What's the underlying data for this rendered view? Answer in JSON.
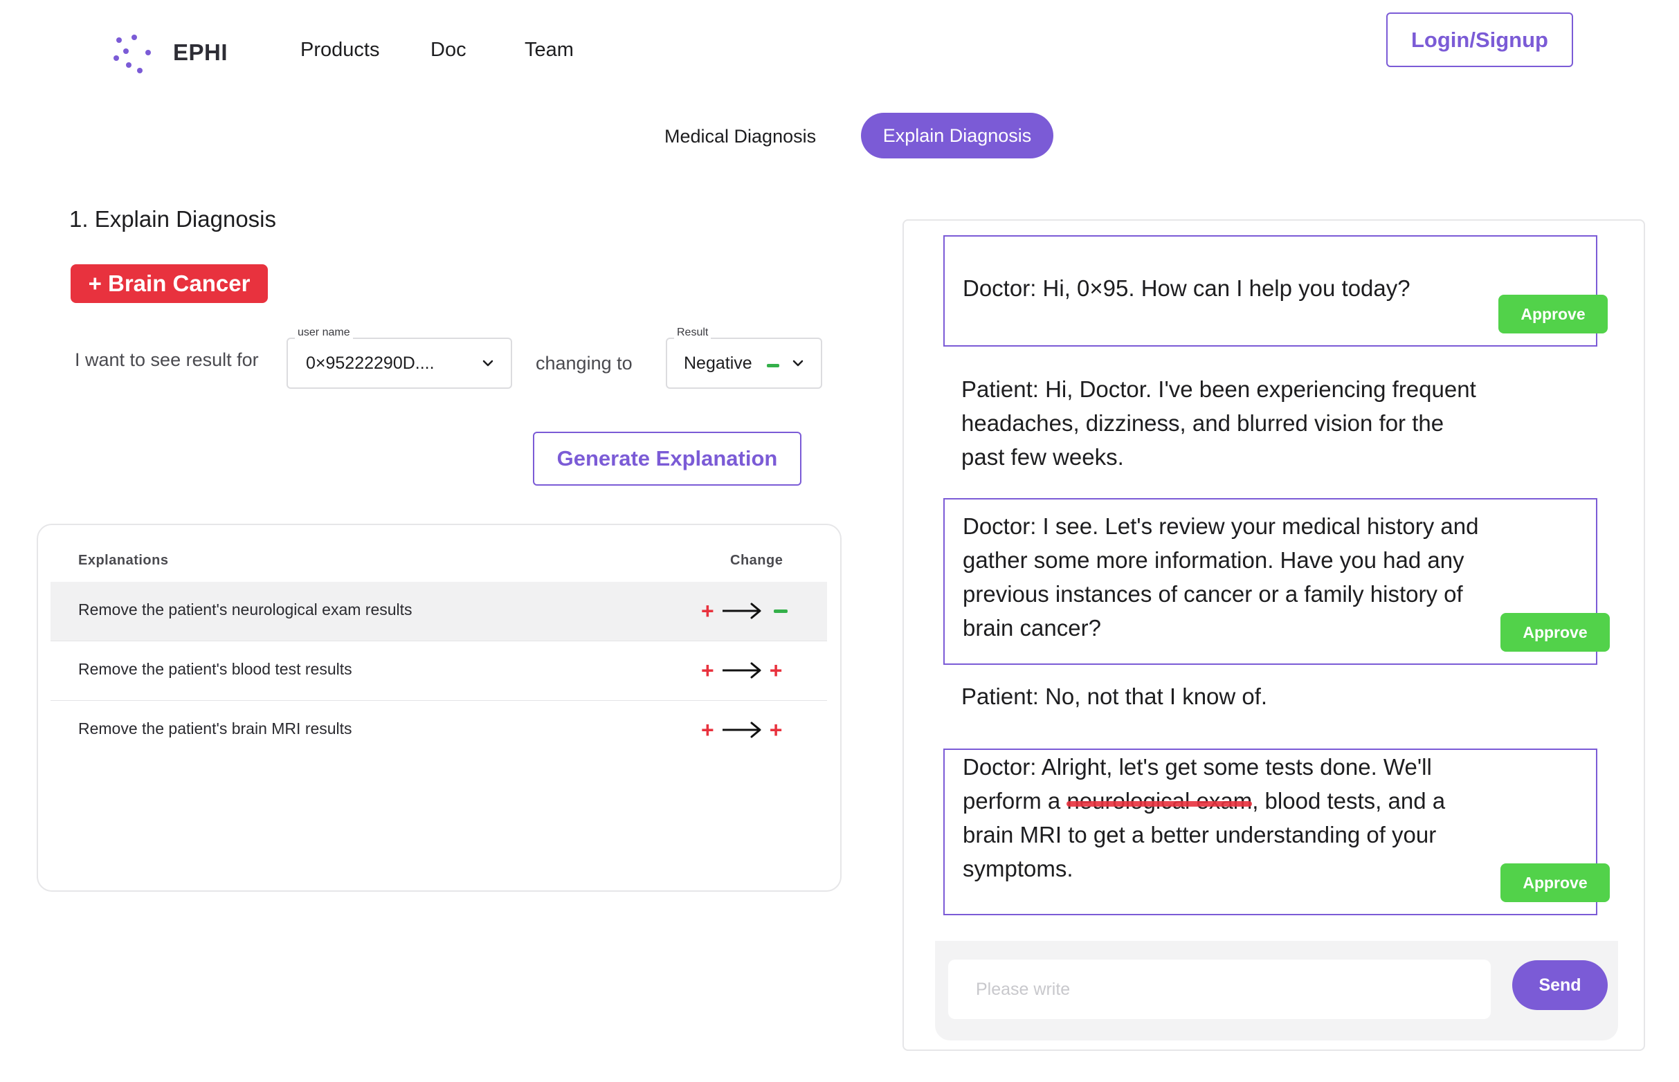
{
  "brand": {
    "name": "EPHI"
  },
  "nav": {
    "products": "Products",
    "doc": "Doc",
    "team": "Team",
    "login": "Login/Signup"
  },
  "tabs": {
    "medical": "Medical Diagnosis",
    "explain": "Explain Diagnosis",
    "active": "Explain Diagnosis"
  },
  "section": {
    "title": "1. Explain Diagnosis",
    "badge": "+ Brain Cancer"
  },
  "form": {
    "want_label": "I want to see result for",
    "user_caption": "user name",
    "user_value": "0×95222290D....",
    "changing_label": "changing to",
    "result_caption": "Result",
    "result_value": "Negative",
    "generate": "Generate Explanation"
  },
  "explanations": {
    "col_explanations": "Explanations",
    "col_change": "Change",
    "rows": [
      {
        "text": "Remove the patient's neurological exam results",
        "from": "+",
        "to": "−",
        "selected": true
      },
      {
        "text": "Remove the patient's blood test results",
        "from": "+",
        "to": "+",
        "selected": false
      },
      {
        "text": "Remove the patient's brain MRI results",
        "from": "+",
        "to": "+",
        "selected": false
      }
    ]
  },
  "chat": {
    "m1": {
      "line1": "Doctor: Hi, 0×95. How can I help you today?"
    },
    "m2": {
      "line1": "Patient: Hi, Doctor. I've been experiencing frequent",
      "line2": "headaches, dizziness, and blurred vision for the",
      "line3": "past few weeks."
    },
    "m3": {
      "line1": "Doctor: I see. Let's review your medical history and",
      "line2": "gather some more information. Have you had any",
      "line3": "previous instances of cancer or a family history of",
      "line4": "brain cancer?"
    },
    "m4": {
      "line1": "Patient: No, not that I know of."
    },
    "m5": {
      "line1": "Doctor: Alright, let's get some tests done. We'll",
      "line2_pre": "perform a ",
      "line2_struck": "neurological exam",
      "line2_post": ", blood tests, and a",
      "line3": "brain MRI to get a better understanding of your",
      "line4": "symptoms."
    },
    "approve": "Approve",
    "placeholder": "Please write",
    "send": "Send"
  },
  "colors": {
    "accent": "#7b5bd6",
    "danger": "#e8323e",
    "success": "#52d24a"
  }
}
